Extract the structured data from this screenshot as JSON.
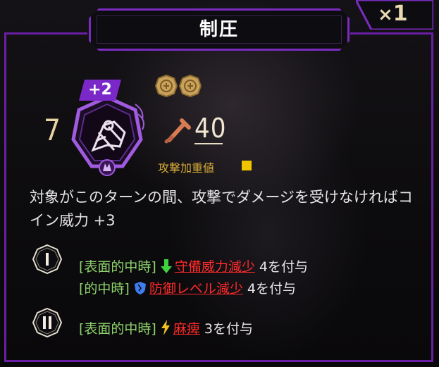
{
  "card": {
    "title": "制圧",
    "count": "1",
    "level": "7",
    "offense_bonus": "+2",
    "coin_count": 2,
    "power": "40",
    "attack_weight_label": "攻撃加重値",
    "attack_weight_slots": 1,
    "description": "対象がこのターンの間、攻撃でダメージを受けなければコイン威力 +3"
  },
  "coins": [
    {
      "numeral": "I",
      "effects": [
        {
          "trigger": "[表面的中時]",
          "icon": "arrow-down-icon",
          "status": "守備威力減少",
          "amount": "4を付与"
        },
        {
          "trigger": "[的中時]",
          "icon": "shield-break-icon",
          "status": "防御レベル減少",
          "amount": "4を付与"
        }
      ]
    },
    {
      "numeral": "II",
      "effects": [
        {
          "trigger": "[表面的中時]",
          "icon": "lightning-icon",
          "status": "麻痺",
          "amount": "3を付与"
        }
      ]
    }
  ],
  "colors": {
    "frame": "#6a1fa5",
    "trigger_text": "#8fd46c",
    "status_text": "#ff2a2a",
    "attack_weight": "#f1c400"
  }
}
